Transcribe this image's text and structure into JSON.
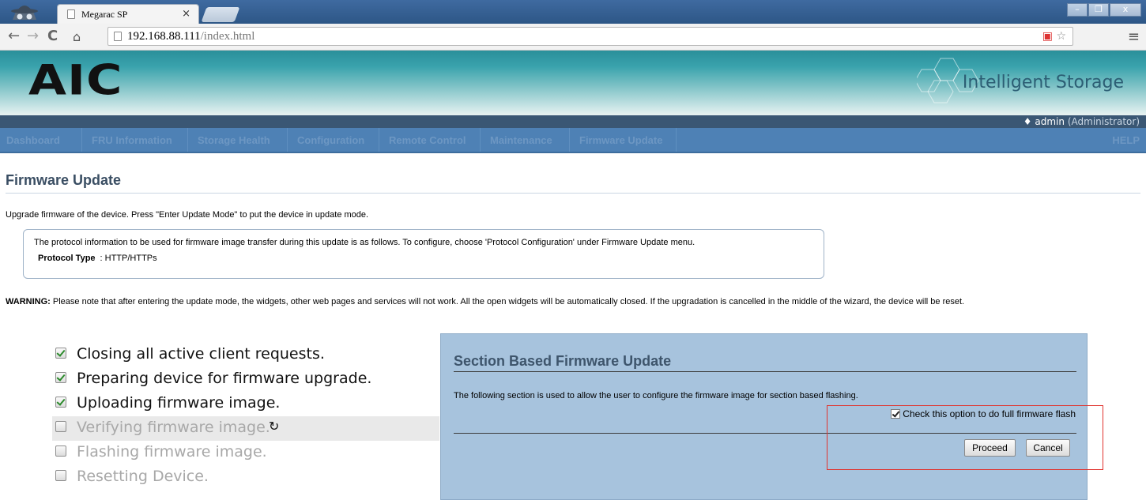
{
  "browser": {
    "tab_title": "Megarac SP",
    "tab_close": "×",
    "url_host": "192.168.88.111",
    "url_path": "/index.html",
    "window_buttons": [
      "–",
      "❐",
      "x"
    ]
  },
  "header": {
    "logo": "AIC",
    "product_name": "Intelligent Storage",
    "user_icon": "♦",
    "user_name": "admin",
    "user_role": "(Administrator)"
  },
  "nav": {
    "items": [
      "Dashboard",
      "FRU Information",
      "Storage Health",
      "Configuration",
      "Remote Control",
      "Maintenance",
      "Firmware Update"
    ],
    "help": "HELP"
  },
  "page": {
    "title": "Firmware Update",
    "intro": "Upgrade firmware of the device. Press \"Enter Update Mode\" to put the device in update mode.",
    "protocol_info": "The protocol information to be used for firmware image transfer during this update is as follows. To configure, choose 'Protocol Configuration' under Firmware Update menu.",
    "protocol_type_label": "Protocol Type",
    "protocol_type_value": ": HTTP/HTTPs",
    "warning_label": "WARNING:",
    "warning_text": " Please note that after entering the update mode, the widgets, other web pages and services will not work. All the open widgets will be automatically closed. If the upgradation is cancelled in the middle of the wizard, the device will be reset."
  },
  "steps": [
    {
      "label": "Closing all active client requests.",
      "status": "done"
    },
    {
      "label": "Preparing device for firmware upgrade.",
      "status": "done"
    },
    {
      "label": "Uploading firmware image.",
      "status": "done"
    },
    {
      "label": "Verifying firmware image.",
      "status": "in-progress"
    },
    {
      "label": "Flashing firmware image.",
      "status": "pending"
    },
    {
      "label": "Resetting Device.",
      "status": "pending"
    }
  ],
  "section_panel": {
    "title": "Section Based Firmware Update",
    "description": "The following section is used to allow the user to configure the firmware image for section based flashing.",
    "full_flash_label": "Check this option to do full firmware flash",
    "full_flash_checked": true,
    "proceed_label": "Proceed",
    "cancel_label": "Cancel"
  },
  "colors": {
    "nav_bg": "#4e81b5",
    "panel_bg": "#a7c3dd",
    "highlight_border": "#e0342f",
    "check_green": "#2b8a2b"
  }
}
